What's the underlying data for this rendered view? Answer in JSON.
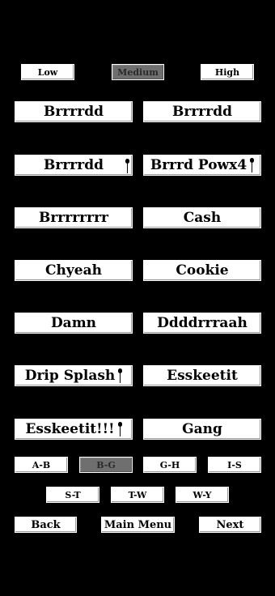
{
  "intensity": {
    "low": "Low",
    "medium": "Medium",
    "high": "High",
    "selected": "Medium"
  },
  "sounds": [
    {
      "label": "Brrrrdd",
      "mic": false
    },
    {
      "label": "Brrrrdd",
      "mic": false
    },
    {
      "label": "Brrrrdd",
      "mic": true
    },
    {
      "label": "Brrrd Powx4",
      "mic": true
    },
    {
      "label": "Brrrrrrrr",
      "mic": false
    },
    {
      "label": "Cash",
      "mic": false
    },
    {
      "label": "Chyeah",
      "mic": false
    },
    {
      "label": "Cookie",
      "mic": false
    },
    {
      "label": "Damn",
      "mic": false
    },
    {
      "label": "Ddddrrraah",
      "mic": false
    },
    {
      "label": "Drip Splash",
      "mic": true
    },
    {
      "label": "Esskeetit",
      "mic": false
    },
    {
      "label": "Esskeetit!!!",
      "mic": true
    },
    {
      "label": "Gang",
      "mic": false
    }
  ],
  "ranges": {
    "a_b": "A-B",
    "b_g": "B-G",
    "g_h": "G-H",
    "i_s": "I-S",
    "s_t": "S-T",
    "t_w": "T-W",
    "w_y": "W-Y",
    "selected": "B-G"
  },
  "nav": {
    "back": "Back",
    "main_menu": "Main Menu",
    "next": "Next"
  },
  "icons": {
    "mic": "microphone-icon"
  }
}
